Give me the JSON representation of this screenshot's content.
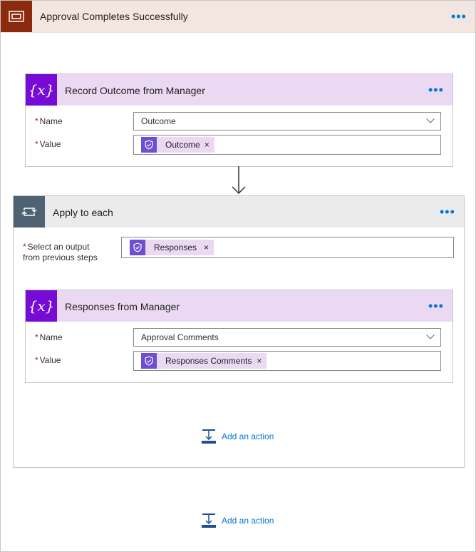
{
  "scope": {
    "title": "Approval Completes Successfully",
    "icon": "scope-icon",
    "more": "•••"
  },
  "record_outcome": {
    "title": "Record Outcome from Manager",
    "icon": "variable-icon",
    "name_label": "Name",
    "name_value": "Outcome",
    "value_label": "Value",
    "value_token": "Outcome",
    "more": "•••"
  },
  "apply_each": {
    "title": "Apply to each",
    "icon": "loop-icon",
    "select_label_line1": "Select an output",
    "select_label_line2": "from previous steps",
    "select_token": "Responses",
    "more": "•••"
  },
  "responses_manager": {
    "title": "Responses from Manager",
    "icon": "variable-icon",
    "name_label": "Name",
    "name_value": "Approval Comments",
    "value_label": "Value",
    "value_token": "Responses Comments",
    "more": "•••"
  },
  "inner_add_action": "Add an action",
  "outer_add_action": "Add an action",
  "required_mark": "*",
  "remove_mark": "×",
  "var_glyph": "{x}",
  "colors": {
    "scope_accent": "#8b2a0d",
    "variable_accent": "#770bd6",
    "loop_accent": "#4e6273",
    "link": "#0078d4"
  }
}
